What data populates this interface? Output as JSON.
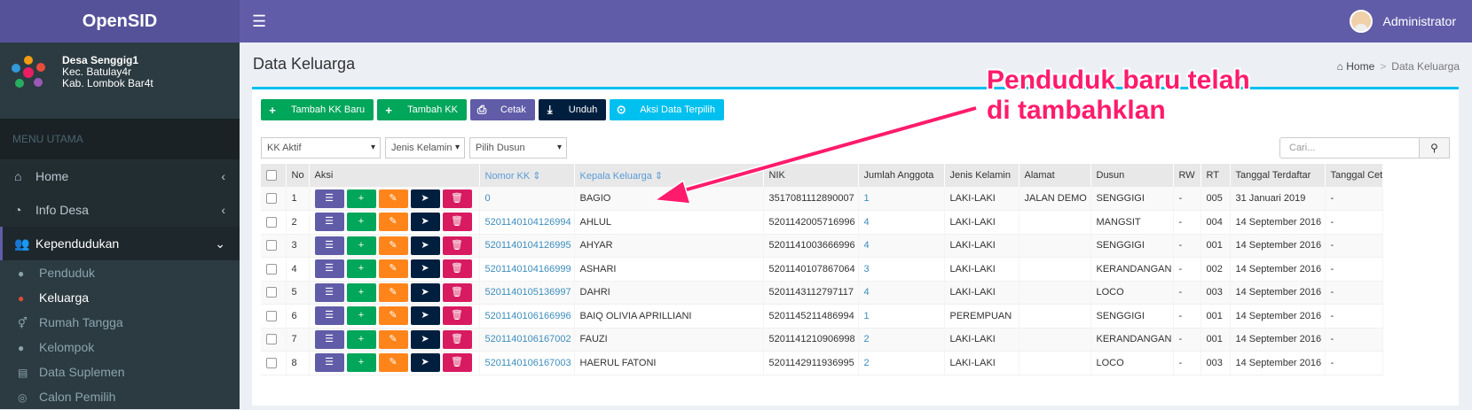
{
  "app": {
    "name": "OpenSID",
    "user": "Administrator"
  },
  "desa": {
    "name": "Desa Senggig1",
    "kec": "Kec. Batulay4r",
    "kab": "Kab. Lombok Bar4t"
  },
  "sidebar": {
    "header": "MENU UTAMA",
    "items": [
      {
        "label": "Home",
        "icon": "home-icon"
      },
      {
        "label": "Info Desa",
        "icon": "dashboard-icon"
      },
      {
        "label": "Kependudukan",
        "icon": "users-icon"
      }
    ],
    "sub": [
      {
        "label": "Penduduk"
      },
      {
        "label": "Keluarga"
      },
      {
        "label": "Rumah Tangga"
      },
      {
        "label": "Kelompok"
      },
      {
        "label": "Data Suplemen"
      },
      {
        "label": "Calon Pemilih"
      }
    ]
  },
  "page": {
    "title": "Data Keluarga",
    "crumb_home": "Home",
    "crumb_current": "Data Keluarga"
  },
  "buttons": {
    "tambah_kk_baru": "Tambah KK Baru",
    "tambah_kk": "Tambah KK",
    "cetak": "Cetak",
    "unduh": "Unduh",
    "aksi": "Aksi Data Terpilih"
  },
  "filters": {
    "status": "KK Aktif",
    "jk": "Jenis Kelamin",
    "dusun": "Pilih Dusun",
    "search_placeholder": "Cari..."
  },
  "table": {
    "headers": [
      "No",
      "Aksi",
      "Nomor KK ⇕",
      "Kepala Keluarga ⇕",
      "NIK",
      "Jumlah Anggota",
      "Jenis Kelamin",
      "Alamat",
      "Dusun",
      "RW",
      "RT",
      "Tanggal Terdaftar",
      "Tanggal Cet"
    ],
    "rows": [
      {
        "no": "1",
        "kk": "0",
        "kepala": "BAGIO",
        "nik": "3517081112890007",
        "jml": "1",
        "jk": "LAKI-LAKI",
        "alamat": "JALAN DEMO",
        "dusun": "SENGGIGI",
        "rw": "-",
        "rt": "005",
        "tgl": "31 Januari 2019",
        "cet": "-"
      },
      {
        "no": "2",
        "kk": "5201140104126994",
        "kepala": "AHLUL",
        "nik": "5201142005716996",
        "jml": "4",
        "jk": "LAKI-LAKI",
        "alamat": "",
        "dusun": "MANGSIT",
        "rw": "-",
        "rt": "004",
        "tgl": "14 September 2016",
        "cet": "-"
      },
      {
        "no": "3",
        "kk": "5201140104126995",
        "kepala": "AHYAR",
        "nik": "5201141003666996",
        "jml": "4",
        "jk": "LAKI-LAKI",
        "alamat": "",
        "dusun": "SENGGIGI",
        "rw": "-",
        "rt": "001",
        "tgl": "14 September 2016",
        "cet": "-"
      },
      {
        "no": "4",
        "kk": "5201140104166999",
        "kepala": "ASHARI",
        "nik": "5201140107867064",
        "jml": "3",
        "jk": "LAKI-LAKI",
        "alamat": "",
        "dusun": "KERANDANGAN",
        "rw": "-",
        "rt": "002",
        "tgl": "14 September 2016",
        "cet": "-"
      },
      {
        "no": "5",
        "kk": "5201140105136997",
        "kepala": "DAHRI",
        "nik": "5201143112797117",
        "jml": "4",
        "jk": "LAKI-LAKI",
        "alamat": "",
        "dusun": "LOCO",
        "rw": "-",
        "rt": "003",
        "tgl": "14 September 2016",
        "cet": "-"
      },
      {
        "no": "6",
        "kk": "5201140106166996",
        "kepala": "BAIQ OLIVIA APRILLIANI",
        "nik": "5201145211486994",
        "jml": "1",
        "jk": "PEREMPUAN",
        "alamat": "",
        "dusun": "SENGGIGI",
        "rw": "-",
        "rt": "001",
        "tgl": "14 September 2016",
        "cet": "-"
      },
      {
        "no": "7",
        "kk": "5201140106167002",
        "kepala": "FAUZI",
        "nik": "5201141210906998",
        "jml": "2",
        "jk": "LAKI-LAKI",
        "alamat": "",
        "dusun": "KERANDANGAN",
        "rw": "-",
        "rt": "001",
        "tgl": "14 September 2016",
        "cet": "-"
      },
      {
        "no": "8",
        "kk": "5201140106167003",
        "kepala": "HAERUL FATONI",
        "nik": "5201142911936995",
        "jml": "2",
        "jk": "LAKI-LAKI",
        "alamat": "",
        "dusun": "LOCO",
        "rw": "-",
        "rt": "003",
        "tgl": "14 September 2016",
        "cet": "-"
      }
    ]
  },
  "annotation": {
    "line1": "Penduduk baru telah",
    "line2": "di tambahklan"
  },
  "colors": {
    "purple": "#605ca8",
    "green": "#00a65a",
    "orange": "#ff851b",
    "navy": "#001f3f",
    "pink": "#d81b60",
    "aqua": "#00c0ef",
    "annotation": "#ff1b6b"
  }
}
